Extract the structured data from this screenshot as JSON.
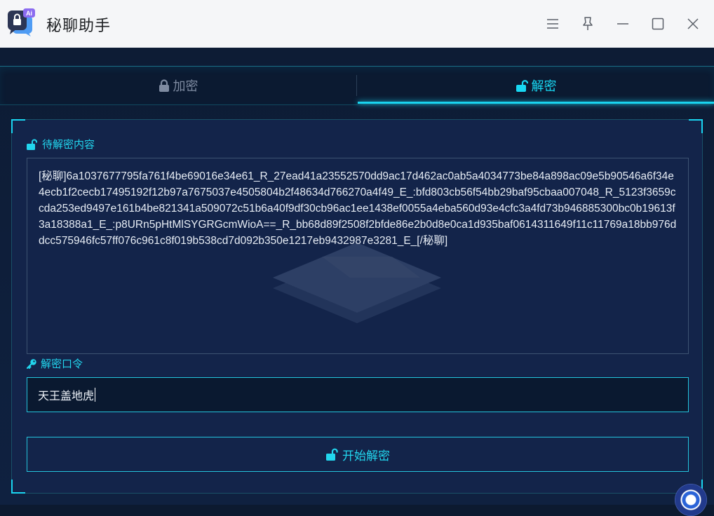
{
  "app": {
    "title": "秘聊助手",
    "icon_name": "chat-lock-app-icon",
    "badge": "Ai"
  },
  "window_controls": [
    "menu-icon",
    "pin-icon",
    "minimize-icon",
    "maximize-icon",
    "close-icon"
  ],
  "tabs": [
    {
      "label": "加密",
      "icon": "lock-icon",
      "active": false
    },
    {
      "label": "解密",
      "icon": "unlock-icon",
      "active": true
    }
  ],
  "decrypt_panel": {
    "content_label": "待解密内容",
    "content_value": "[秘聊]6a1037677795fa761f4be69016e34e61_R_27ead41a23552570dd9ac17d462ac0ab5a4034773be84a898ac09e5b90546a6f34e4ecb1f2cecb17495192f12b97a7675037e4505804b2f48634d766270a4f49_E_:bfd803cb56f54bb29baf95cbaa007048_R_5123f3659ccda253ed9497e161b4be821341a509072c51b6a40f9df30cb96ac1ee1438ef0055a4eba560d93e4cfc3a4fd73b946885300bc0b19613f3a18388a1_E_:p8URn5pHtMlSYGRGcmWioA==_R_bb68d89f2508f2bfde86e2b0d8e0ca1d935baf0614311649f11c11769a18bb976ddcc575946fc57ff076c961c8f019b538cd7d092b350e1217eb9432987e3281_E_[/秘聊]",
    "key_label": "解密口令",
    "key_value": "天王盖地虎",
    "button_label": "开始解密"
  },
  "colors": {
    "accent": "#1ad5f0",
    "background": "#0c1a30",
    "panel": "#13244a",
    "titlebar": "#f5f6f8"
  }
}
